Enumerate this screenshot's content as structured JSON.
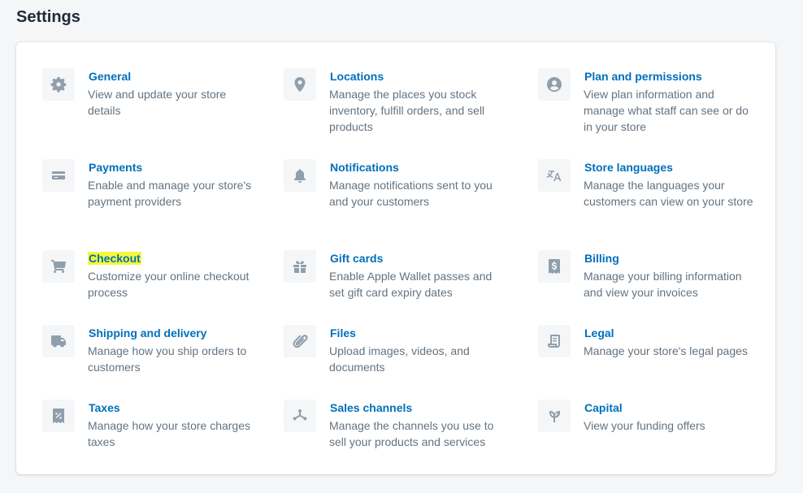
{
  "page": {
    "title": "Settings"
  },
  "colors": {
    "link": "#006fbb",
    "muted": "#637381",
    "highlight": "#f5f93a",
    "icon": "#919eab"
  },
  "settings": [
    {
      "title": "General",
      "desc": "View and update your store details",
      "icon": "gear-icon"
    },
    {
      "title": "Locations",
      "desc": "Manage the places you stock inventory, fulfill orders, and sell products",
      "icon": "location-pin-icon"
    },
    {
      "title": "Plan and permissions",
      "desc": "View plan information and manage what staff can see or do in your store",
      "icon": "user-circle-icon"
    },
    {
      "title": "Payments",
      "desc": "Enable and manage your store's payment providers",
      "icon": "credit-card-icon"
    },
    {
      "title": "Notifications",
      "desc": "Manage notifications sent to you and your customers",
      "icon": "bell-icon"
    },
    {
      "title": "Store languages",
      "desc": "Manage the languages your customers can view on your store",
      "icon": "translate-icon"
    },
    {
      "title": "Checkout",
      "desc": "Customize your online checkout process",
      "icon": "cart-icon",
      "highlighted": true
    },
    {
      "title": "Gift cards",
      "desc": "Enable Apple Wallet passes and set gift card expiry dates",
      "icon": "gift-icon"
    },
    {
      "title": "Billing",
      "desc": "Manage your billing information and view your invoices",
      "icon": "receipt-dollar-icon"
    },
    {
      "title": "Shipping and delivery",
      "desc": "Manage how you ship orders to customers",
      "icon": "truck-icon"
    },
    {
      "title": "Files",
      "desc": "Upload images, videos, and documents",
      "icon": "paperclip-icon"
    },
    {
      "title": "Legal",
      "desc": "Manage your store's legal pages",
      "icon": "legal-document-icon"
    },
    {
      "title": "Taxes",
      "desc": "Manage how your store charges taxes",
      "icon": "tax-receipt-icon"
    },
    {
      "title": "Sales channels",
      "desc": "Manage the channels you use to sell your products and services",
      "icon": "channels-icon"
    },
    {
      "title": "Capital",
      "desc": "View your funding offers",
      "icon": "plant-icon"
    }
  ]
}
